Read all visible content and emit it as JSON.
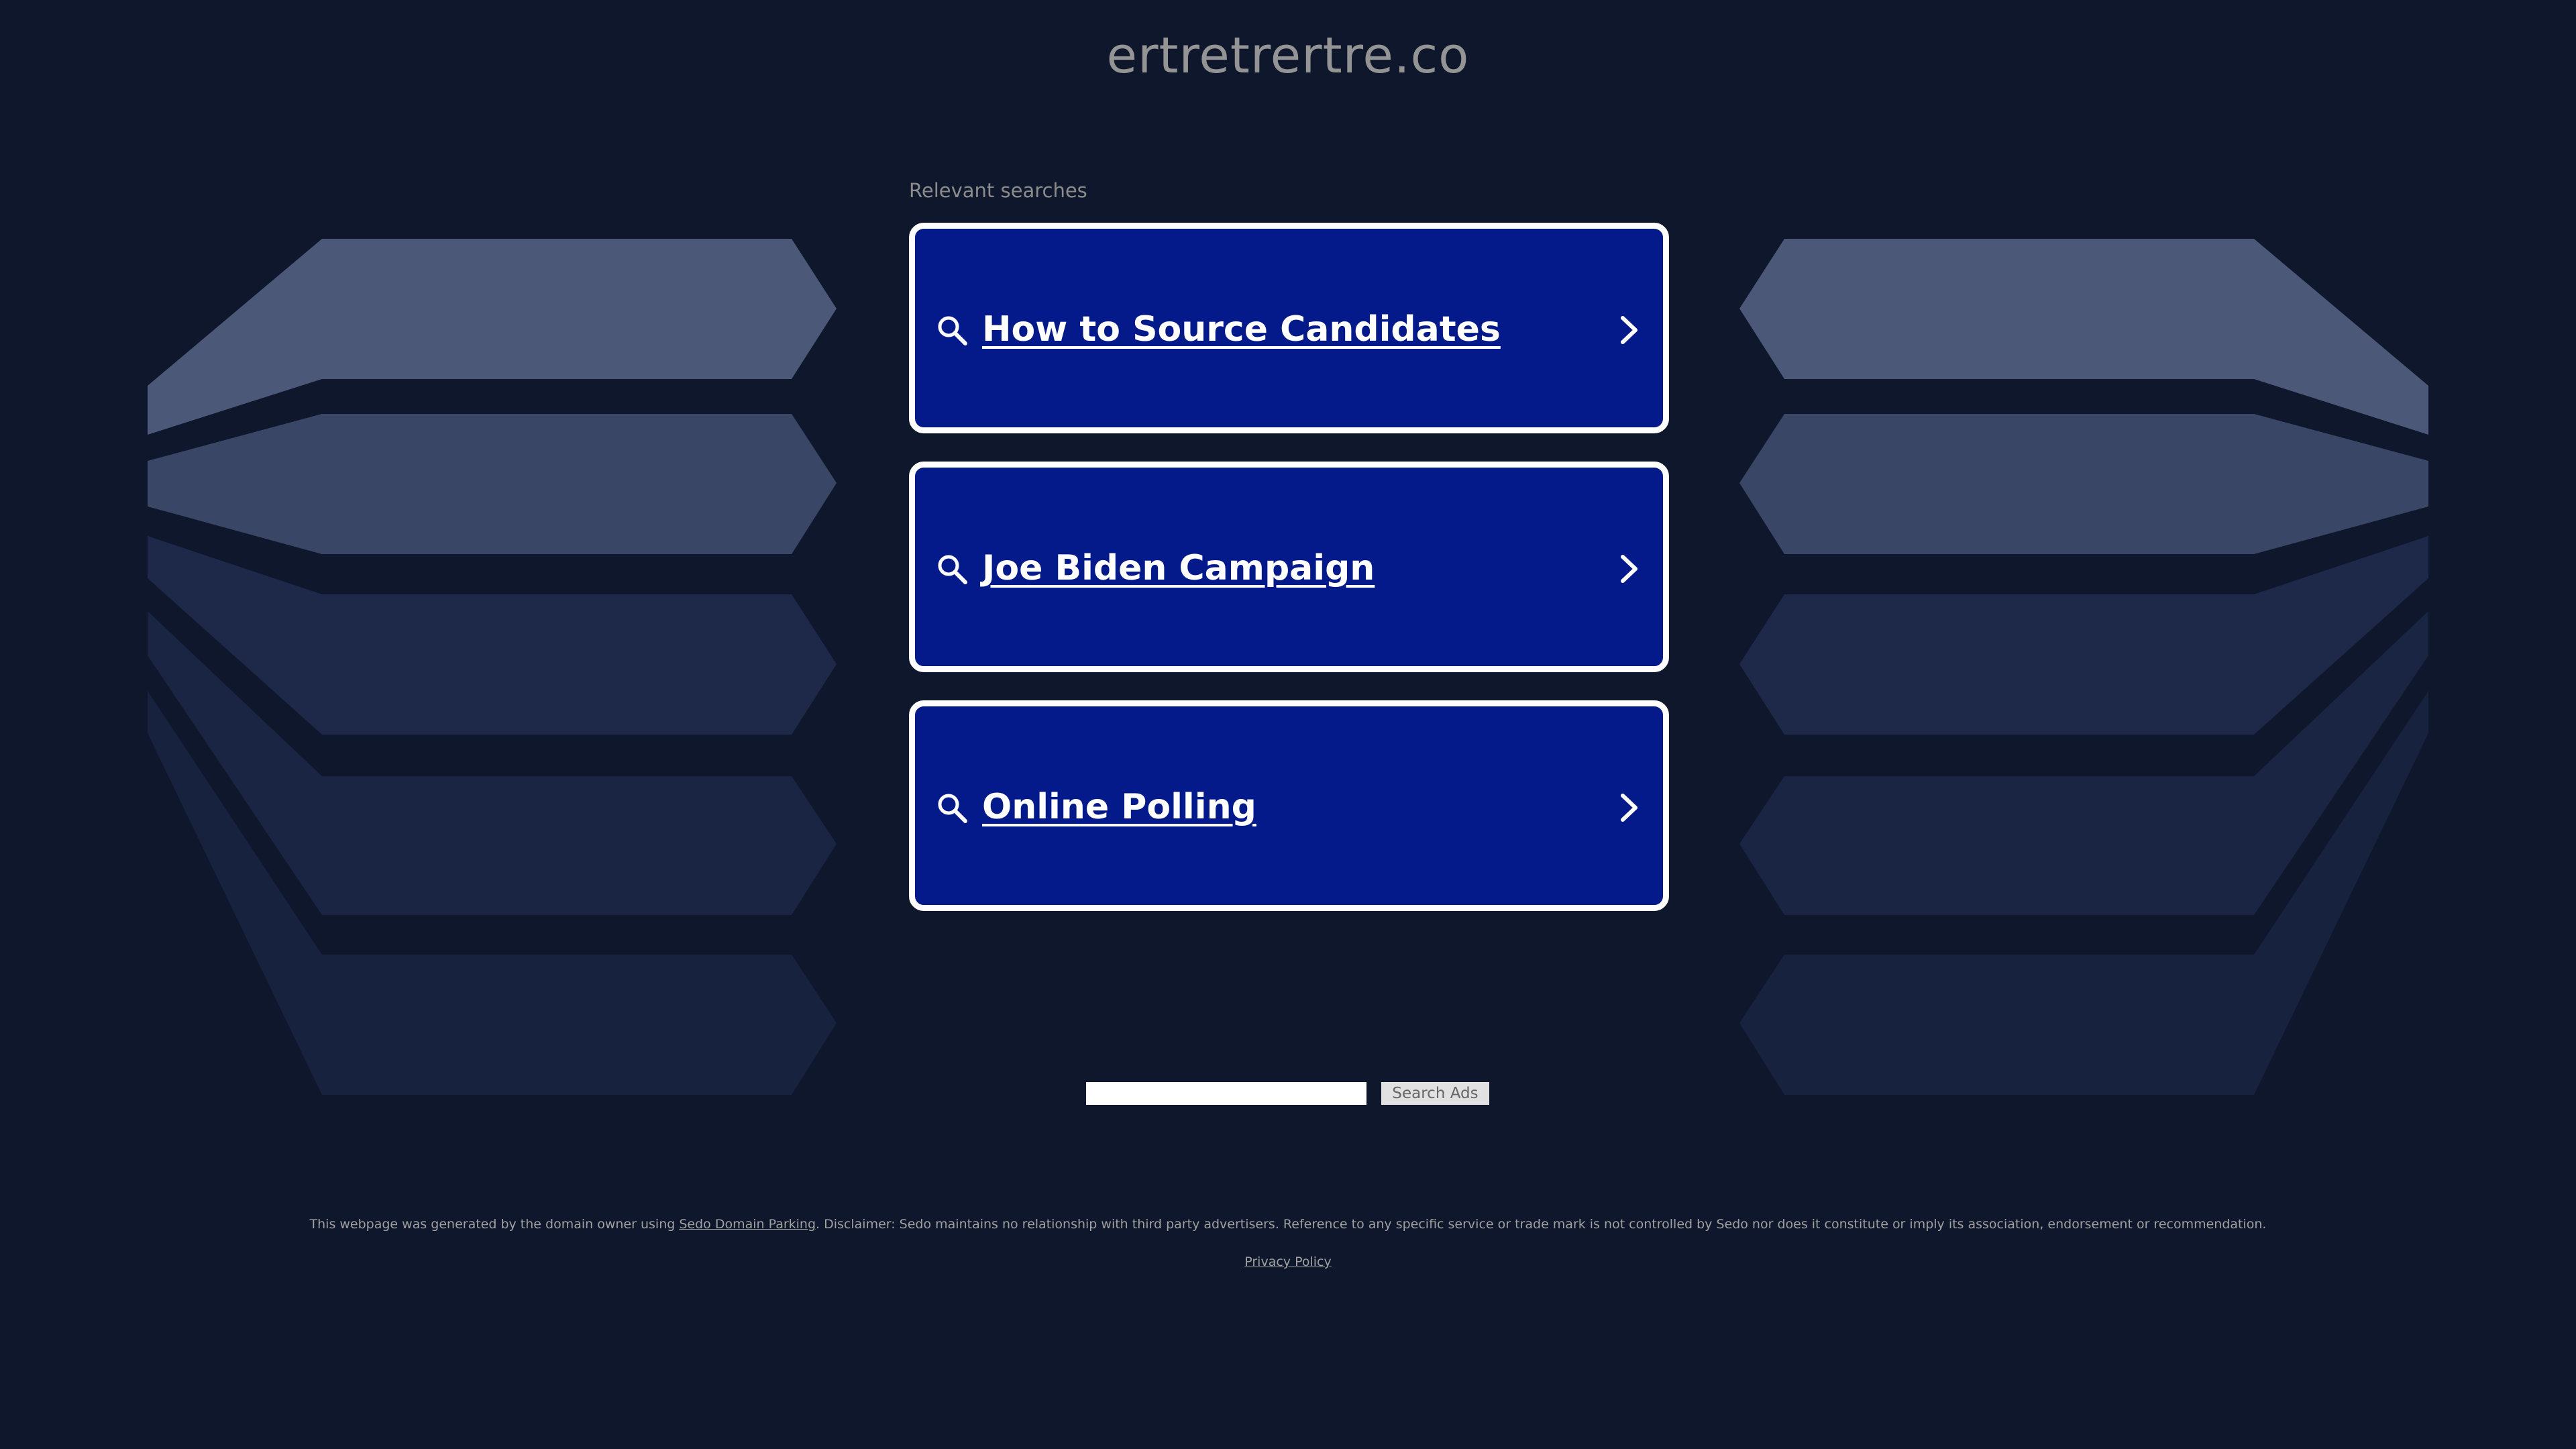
{
  "page": {
    "domain": "ertretrertre.co",
    "relevant_searches_heading": "Relevant searches"
  },
  "related_searches": [
    {
      "label": "How to Source Candidates",
      "icon": "search-icon",
      "action_icon": "chevron-right-icon"
    },
    {
      "label": "Joe Biden Campaign",
      "icon": "search-icon",
      "action_icon": "chevron-right-icon"
    },
    {
      "label": "Online Polling",
      "icon": "search-icon",
      "action_icon": "chevron-right-icon"
    }
  ],
  "search_ads": {
    "input_value": "",
    "button_label": "Search Ads"
  },
  "footer": {
    "disclaimer_prefix": "This webpage was generated by the domain owner using ",
    "sedo_link_label": "Sedo Domain Parking",
    "disclaimer_suffix": ". Disclaimer: Sedo maintains no relationship with third party advertisers. Reference to any specific service or trade mark is not controlled by Sedo nor does it constitute or imply its association, endorsement or recommendation.",
    "privacy_link_label": "Privacy Policy"
  },
  "colors": {
    "background": "#0e172b",
    "card_fill": "#041a8a",
    "card_border": "#ffffff",
    "title_text": "#949494",
    "footer_text": "#a0a0a0"
  }
}
